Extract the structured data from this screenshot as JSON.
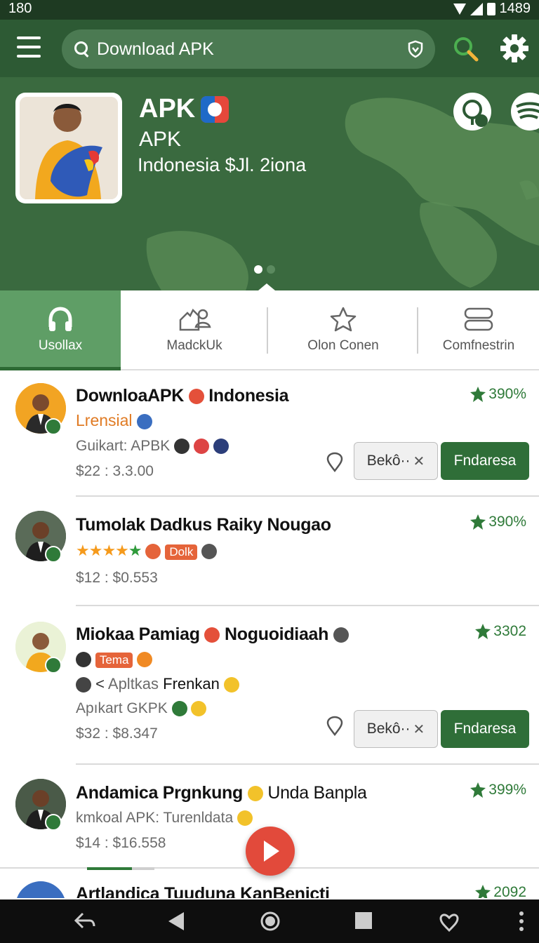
{
  "status_bar": {
    "time": "180",
    "right_time": "1489"
  },
  "header": {
    "search_placeholder": "Download APK",
    "menu_icon": "hamburger-icon",
    "search_icon": "search-icon",
    "settings_icon": "gear-icon"
  },
  "hero": {
    "title": "APK",
    "subtitle": "APK",
    "line": "Indonesia $Jl. 2iona"
  },
  "tabs": [
    {
      "label": "Usollax",
      "icon": "headphones-icon",
      "active": true
    },
    {
      "label": "MadckUk",
      "icon": "users-icon",
      "active": false
    },
    {
      "label": "Olon Conen",
      "icon": "star-icon",
      "active": false
    },
    {
      "label": "Comfnestrin",
      "icon": "stack-icon",
      "active": false
    }
  ],
  "items": [
    {
      "title": "DownloaAPK",
      "title_tail": "Indonesia",
      "percent": "390%",
      "accent": "Lrensial",
      "subtitle": "Guikart: APBK",
      "price": "$22 : 3.3.00",
      "button_secondary": "Bekô··",
      "button_primary": "Fndaresa"
    },
    {
      "title": "Tumolak Dadkus Raiky Nougao",
      "percent": "390%",
      "tag": "Dolk",
      "price": "$12 : $0.553"
    },
    {
      "title": "Miokaa Pamiag",
      "title_tail": "Noguoidiaah",
      "percent": "3302",
      "tag": "Tema",
      "line2_a": "Apltkas",
      "line2_b": "Frenkan",
      "subtitle": "Apıkart GKPK",
      "price": "$32 : $8.347",
      "button_secondary": "Bekô··",
      "button_primary": "Fndaresa"
    },
    {
      "title": "Andamica Prgnkung",
      "title_tail": "Unda Banpla",
      "percent": "399%",
      "subtitle": "kmkoal APK: Turenldata",
      "price": "$14 : $16.558"
    },
    {
      "title": "Artlandica Tuuduna KanBenicti",
      "percent": "2092"
    }
  ],
  "colors": {
    "primary": "#2d5a34",
    "accent_green": "#2f7a39",
    "tab_active": "#5f9e66",
    "fab": "#e24a3b"
  }
}
